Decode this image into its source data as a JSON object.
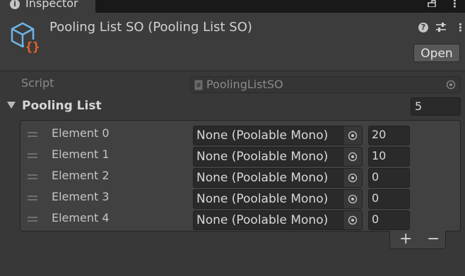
{
  "window": {
    "tab_title": "Inspector"
  },
  "header": {
    "object_title": "Pooling List SO (Pooling List SO)",
    "open_label": "Open"
  },
  "script_row": {
    "label": "Script",
    "value": "PoolingListSO"
  },
  "list": {
    "label": "Pooling List",
    "size": "5",
    "elements": [
      {
        "label": "Element 0",
        "object": "None (Poolable Mono)",
        "count": "20"
      },
      {
        "label": "Element 1",
        "object": "None (Poolable Mono)",
        "count": "10"
      },
      {
        "label": "Element 2",
        "object": "None (Poolable Mono)",
        "count": "0"
      },
      {
        "label": "Element 3",
        "object": "None (Poolable Mono)",
        "count": "0"
      },
      {
        "label": "Element 4",
        "object": "None (Poolable Mono)",
        "count": "0"
      }
    ],
    "add_label": "+",
    "remove_label": "−"
  },
  "colors": {
    "background": "#383838",
    "header_bg": "#3c3c3c",
    "field_bg": "#2a2a2a",
    "tab_accent": "#3a79bb",
    "icon_orange": "#f0642c",
    "icon_blue": "#6fb3e6"
  },
  "icons": [
    "info-icon",
    "lock-icon",
    "kebab-menu-icon",
    "scriptable-object-icon",
    "help-icon",
    "presets-icon",
    "script-file-icon",
    "object-picker-icon",
    "drag-handle-icon",
    "foldout-arrow-icon"
  ]
}
